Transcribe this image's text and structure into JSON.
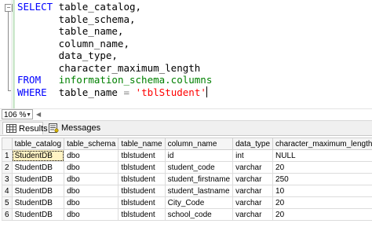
{
  "editor": {
    "lines": [
      {
        "kw": "SELECT",
        "text": " table_catalog,"
      },
      {
        "kw": "",
        "text": "       table_schema,"
      },
      {
        "kw": "",
        "text": "       table_name,"
      },
      {
        "kw": "",
        "text": "       column_name,"
      },
      {
        "kw": "",
        "text": "       data_type,"
      },
      {
        "kw": "",
        "text": "       character_maximum_length"
      }
    ],
    "from_kw": "FROM",
    "from_obj": "information_schema.columns",
    "where_kw": "WHERE",
    "where_col": "table_name",
    "where_op": "=",
    "where_val": "'tblStudent'",
    "fold_symbol": "−"
  },
  "zoom": {
    "value": "106 %"
  },
  "tabs": {
    "results": "Results",
    "messages": "Messages"
  },
  "grid": {
    "columns": [
      "table_catalog",
      "table_schema",
      "table_name",
      "column_name",
      "data_type",
      "character_maximum_length"
    ],
    "rows": [
      {
        "n": "1",
        "cells": [
          "StudentDB",
          "dbo",
          "tblstudent",
          "id",
          "int",
          "NULL"
        ]
      },
      {
        "n": "2",
        "cells": [
          "StudentDB",
          "dbo",
          "tblstudent",
          "student_code",
          "varchar",
          "20"
        ]
      },
      {
        "n": "3",
        "cells": [
          "StudentDB",
          "dbo",
          "tblstudent",
          "student_firstname",
          "varchar",
          "250"
        ]
      },
      {
        "n": "4",
        "cells": [
          "StudentDB",
          "dbo",
          "tblstudent",
          "student_lastname",
          "varchar",
          "10"
        ]
      },
      {
        "n": "5",
        "cells": [
          "StudentDB",
          "dbo",
          "tblstudent",
          "City_Code",
          "varchar",
          "20"
        ]
      },
      {
        "n": "6",
        "cells": [
          "StudentDB",
          "dbo",
          "tblstudent",
          "school_code",
          "varchar",
          "20"
        ]
      }
    ]
  },
  "colors": {
    "keyword": "#0000ff",
    "system": "#008000",
    "string": "#ff0000",
    "selection": "#fff3c4"
  }
}
